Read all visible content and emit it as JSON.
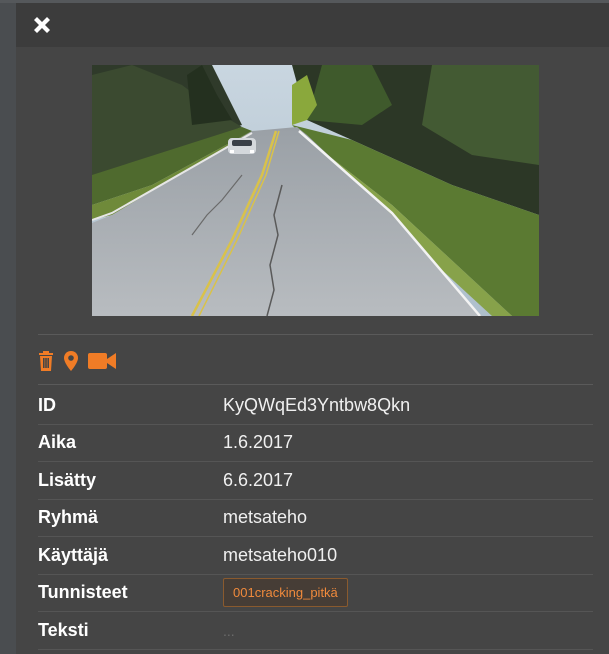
{
  "colors": {
    "accent": "#f07c26",
    "panel": "#454545",
    "header": "#3c3c3c",
    "text": "#ffffff"
  },
  "toolbar": {
    "close_icon": "close-icon",
    "icons": [
      "trash-icon",
      "map-pin-icon",
      "video-camera-icon"
    ]
  },
  "details": {
    "rows": [
      {
        "label": "ID",
        "value": "KyQWqEd3Yntbw8Qkn"
      },
      {
        "label": "Aika",
        "value": "1.6.2017"
      },
      {
        "label": "Lisätty",
        "value": "6.6.2017"
      },
      {
        "label": "Ryhmä",
        "value": "metsateho"
      },
      {
        "label": "Käyttäjä",
        "value": "metsateho010"
      },
      {
        "label": "Tunnisteet",
        "tag": "001cracking_pitkä"
      },
      {
        "label": "Teksti",
        "placeholder": "..."
      }
    ]
  }
}
